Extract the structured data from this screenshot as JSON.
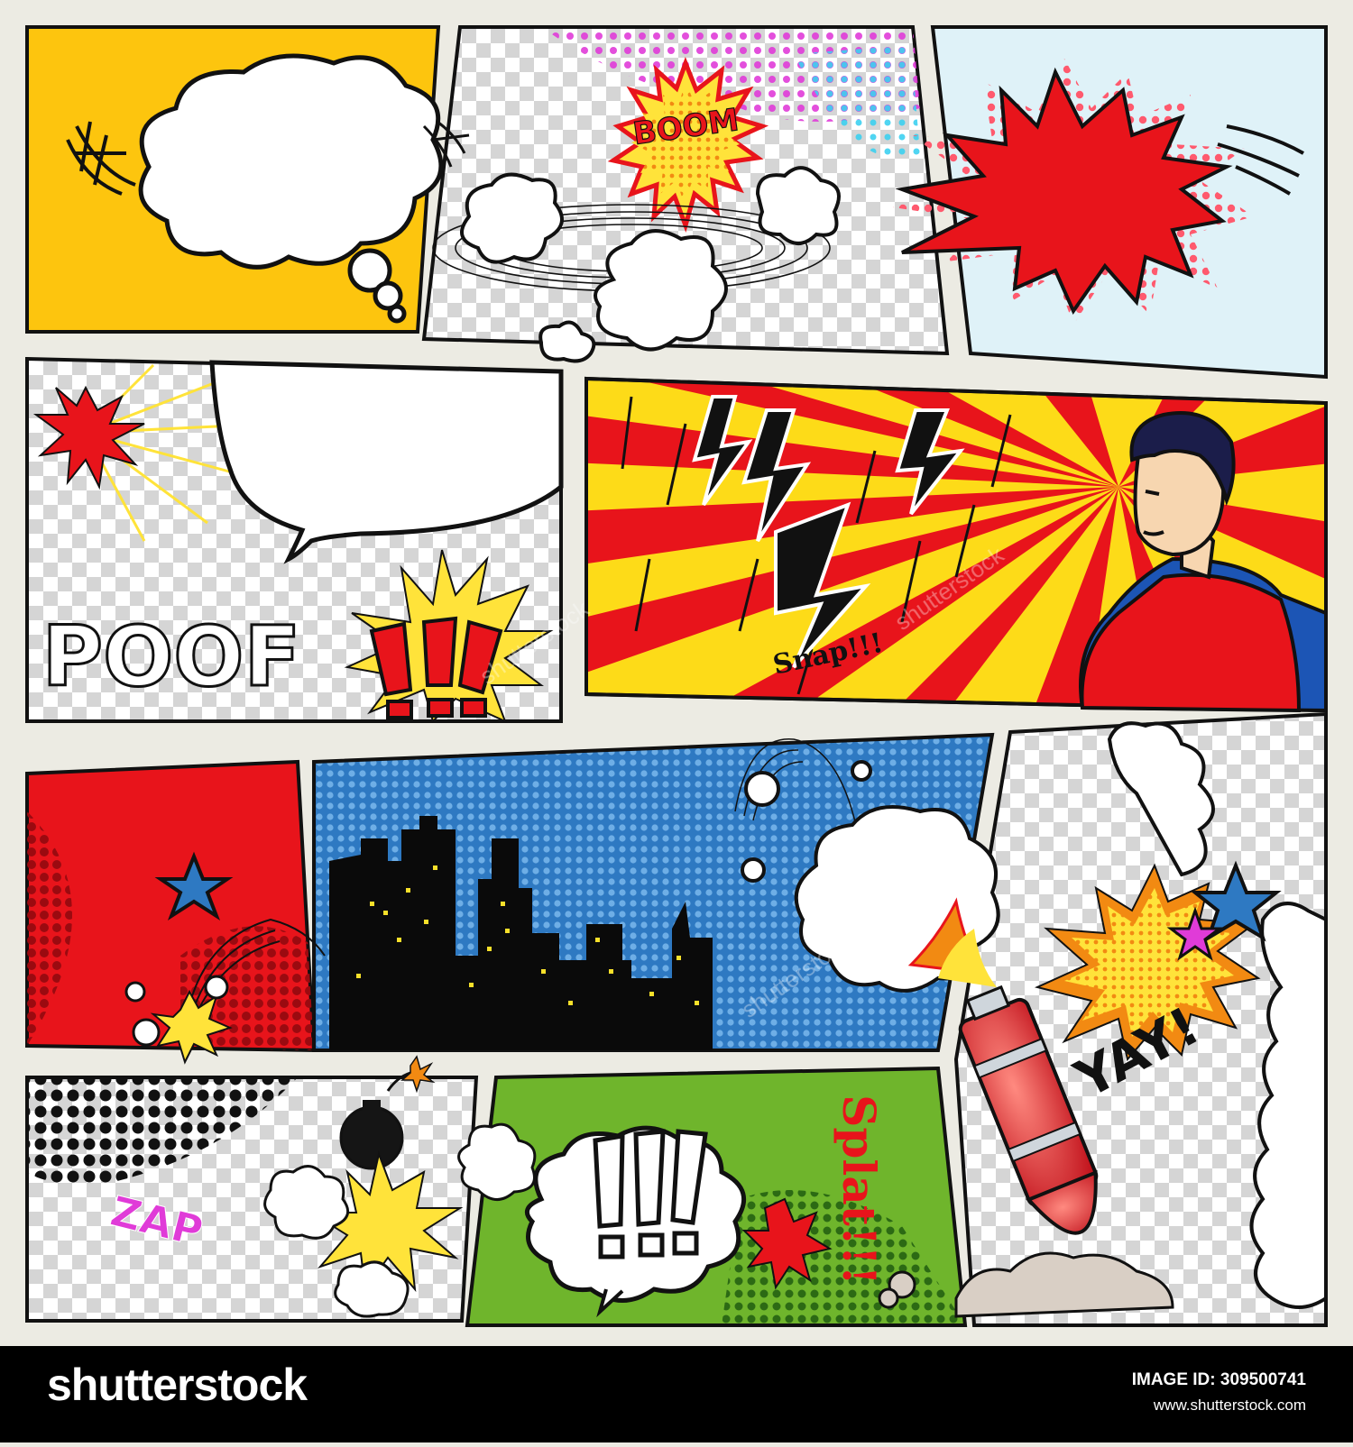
{
  "sound_effects": {
    "boom": "BOOM",
    "poof": "POOF",
    "snap": "Snap!!!",
    "zap": "ZAP",
    "splat": "Splat!!!",
    "yay": "YAY!",
    "exclaim_bang": "!!!",
    "exclaim_cloud": "!!!"
  },
  "footer": {
    "brand": "shutterstock",
    "image_id_label": "IMAGE ID:",
    "image_id": "309500741",
    "url": "www.shutterstock.com"
  },
  "colors": {
    "background": "#ecebe3",
    "yellow": "#fdc50e",
    "red": "#e8141b",
    "blue": "#2e79c2",
    "green": "#6fb52c",
    "light_blue": "#dff2f8",
    "ink": "#111111"
  }
}
